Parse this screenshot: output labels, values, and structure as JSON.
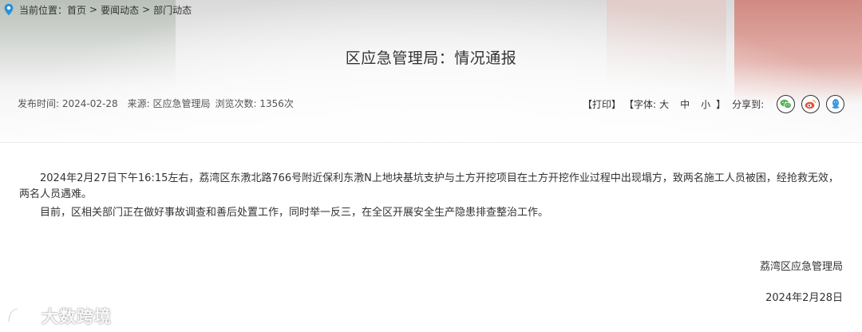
{
  "breadcrumb": {
    "prefix": "当前位置：",
    "items": [
      "首页",
      "要闻动态",
      "部门动态"
    ],
    "separator": ">"
  },
  "article": {
    "title": "区应急管理局：情况通报",
    "meta": {
      "publish_time": "发布时间: 2024-02-28",
      "source": "来源: 区应急管理局",
      "views": "浏览次数: 1356次"
    },
    "paragraphs": [
      "2024年2月27日下午16:15左右，荔湾区东漖北路766号附近保利东漖N上地块基坑支护与土方开挖项目在土方开挖作业过程中出现塌方，致两名施工人员被困，经抢救无效，两名人员遇难。",
      "目前，区相关部门正在做好事故调查和善后处置工作，同时举一反三，在全区开展安全生产隐患排查整治工作。"
    ],
    "signature_org": "荔湾区应急管理局",
    "signature_date": "2024年2月28日"
  },
  "tools": {
    "print": "【打印】",
    "font_prefix": "【字体:",
    "font_large": "大",
    "font_medium": "中",
    "font_small": "小",
    "font_suffix": "】",
    "share_label": "分享到:",
    "share_icons": [
      "wechat-icon",
      "weibo-icon",
      "qq-icon"
    ]
  },
  "watermark": {
    "text": "大数跨境"
  },
  "colors": {
    "wechat": "#5bb25b",
    "weibo": "#e2553d",
    "qq": "#3a9be0",
    "pin": "#2a8fd6"
  }
}
